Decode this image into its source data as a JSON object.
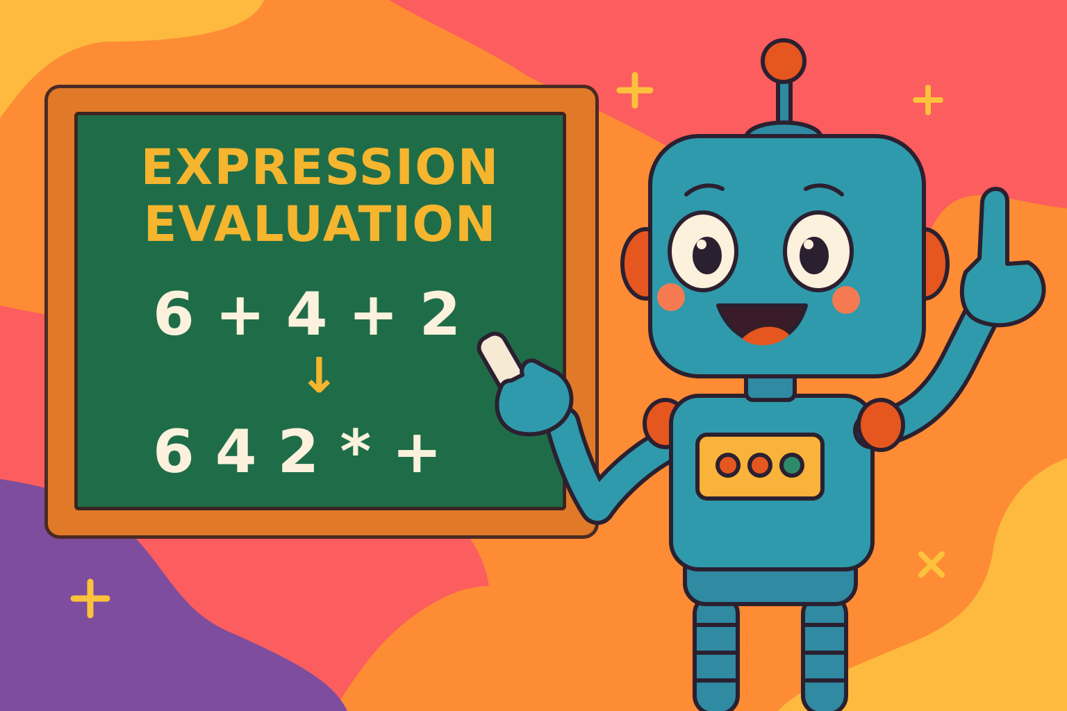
{
  "colors": {
    "board_green": "#1f6d48",
    "board_frame": "#e07a28",
    "title_yellow": "#f5b52e",
    "chalk_white": "#fbf1dc",
    "robot_teal": "#2f9aab",
    "accent_orange": "#e6561f"
  },
  "board": {
    "title_line1": "EXPRESSION",
    "title_line2": "EVALUATION",
    "infix_expression": "6 + 4 + 2",
    "arrow": "↓",
    "postfix_expression": "6 4 2 * +"
  },
  "decorations": {
    "sparkle_symbols": [
      "+",
      "+",
      "+",
      "×"
    ]
  }
}
